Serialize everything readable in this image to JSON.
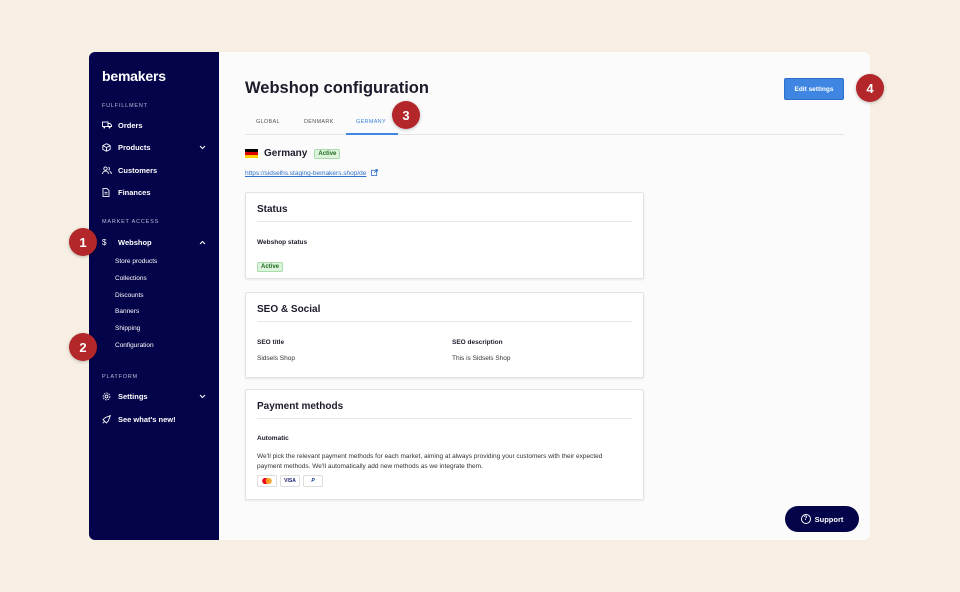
{
  "sidebar": {
    "logo": "bemakers",
    "sections": {
      "fulfillment": "FULFILLMENT",
      "market_access": "MARKET ACCESS",
      "platform": "PLATFORM"
    },
    "items": {
      "orders": "Orders",
      "products": "Products",
      "customers": "Customers",
      "finances": "Finances",
      "webshop": "Webshop",
      "settings": "Settings",
      "whats_new": "See what's new!"
    },
    "webshop_sub": [
      "Store products",
      "Collections",
      "Discounts",
      "Banners",
      "Shipping",
      "Configuration"
    ]
  },
  "header": {
    "title": "Webshop configuration",
    "edit_button": "Edit settings"
  },
  "tabs": [
    "GLOBAL",
    "DENMARK",
    "GERMANY"
  ],
  "active_tab": "GERMANY",
  "country": {
    "name": "Germany",
    "status": "Active",
    "url": "https://sidselhs.staging-bemakers.shop/de"
  },
  "status_card": {
    "title": "Status",
    "label": "Webshop status",
    "value": "Active"
  },
  "seo_card": {
    "title": "SEO & Social",
    "seo_title_label": "SEO title",
    "seo_title_value": "Sidsels Shop",
    "seo_desc_label": "SEO description",
    "seo_desc_value": "This is Sidsels Shop"
  },
  "payment_card": {
    "title": "Payment methods",
    "label": "Automatic",
    "description": "We'll pick the relevant payment methods for each market, aiming at always providing your customers with their expected payment methods. We'll automatically add new methods as we integrate them.",
    "methods": [
      "mastercard-icon",
      "VISA",
      "P"
    ]
  },
  "support_button": "Support",
  "markers": [
    "1",
    "2",
    "3",
    "4"
  ],
  "colors": {
    "sidebar_bg": "#04044a",
    "accent": "#3f86e3",
    "marker": "#b3262a",
    "active_badge_bg": "#dcf3dc"
  }
}
